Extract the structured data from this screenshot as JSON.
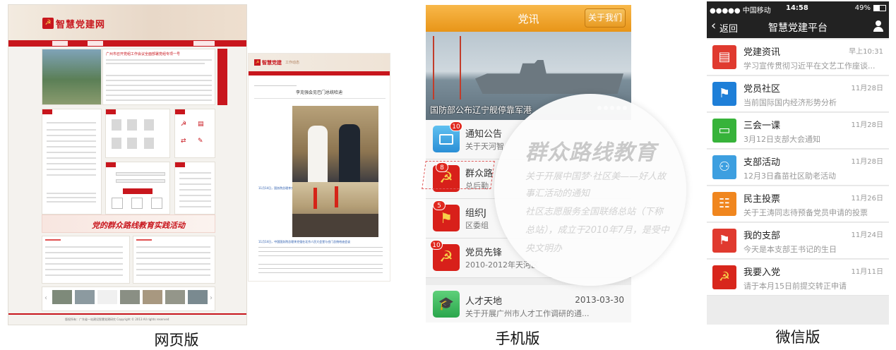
{
  "captions": {
    "web": "网页版",
    "mobile": "手机版",
    "wechat": "微信版"
  },
  "web": {
    "logo": "智慧党建网",
    "feature_headline": "广州市召开党组工作会议全面部署党组专项一号",
    "banner_text": "党的群众路线教育实践活动",
    "boxes": [
      "党员",
      "支部",
      "工作",
      "动态",
      "学习",
      "专题"
    ],
    "list_sample": "关于召开党组工作会议的通知",
    "footer": "版权所有：广东省—站建设智慧党建研究 Copyright © 2013 All rights reserved"
  },
  "article": {
    "logo": "智慧党建",
    "subtitle": "工作动态",
    "title": "李克强会见巴门总统哈迪",
    "caption1": "11月14日，国务院总理李克强在北京人民大会堂会见也门总统哈迪",
    "caption2": "11月14日，中国国务院总理李克强在北京人民大会堂与也门总统哈迪会谈"
  },
  "mobile": {
    "title": "党讯",
    "about_button": "关于我们",
    "hero_caption": "国防部公布辽宁舰停靠军港",
    "items": [
      {
        "title": "通知公告",
        "sub": "关于天河智",
        "badge": "10",
        "date": ""
      },
      {
        "title": "群众路",
        "sub": "总后勤",
        "badge": "8",
        "date": ""
      },
      {
        "title": "组织J",
        "sub": "区委组",
        "badge": "5",
        "date": ""
      },
      {
        "title": "党员先锋",
        "sub": "2010-2012年天河区",
        "badge": "10",
        "date": ""
      },
      {
        "title": "人才天地",
        "sub": "关于开展广州市人才工作调研的通...",
        "badge": "",
        "date": "2013-03-30"
      }
    ],
    "magnifier": {
      "title": "群众路线教育",
      "lines": [
        "关于开展中国梦·社区美——好人故",
        "事汇活动的通知",
        "社区志愿服务全国联络总站（下称",
        "总站），成立于2010年7月，是受中",
        "央文明办"
      ]
    }
  },
  "wechat": {
    "status": {
      "carrier": "●●●●● 中国移动",
      "time": "14:58",
      "battery": "49%"
    },
    "back": "返回",
    "title": "智慧党建平台",
    "items": [
      {
        "title": "党建资讯",
        "sub": "学习宣传贯彻习近平在文艺工作座谈...",
        "date": "早上10:31",
        "color": "#e03a2f"
      },
      {
        "title": "党员社区",
        "sub": "当前国际国内经济形势分析",
        "date": "11月28日",
        "color": "#1e7fd8"
      },
      {
        "title": "三会一课",
        "sub": "3月12日支部大会通知",
        "date": "11月28日",
        "color": "#37b33a"
      },
      {
        "title": "支部活动",
        "sub": "12月3日鑫苗社区助老活动",
        "date": "11月28日",
        "color": "#3d9fe0"
      },
      {
        "title": "民主投票",
        "sub": "关于王涛同志待预备党员申请的投票",
        "date": "11月26日",
        "color": "#f0861e"
      },
      {
        "title": "我的支部",
        "sub": "今天是本支部王书记的生日",
        "date": "11月24日",
        "color": "#e03a2f"
      },
      {
        "title": "我要入党",
        "sub": "请于本月15日前提交转正申请",
        "date": "11月11日",
        "color": "#d8261c"
      }
    ]
  }
}
